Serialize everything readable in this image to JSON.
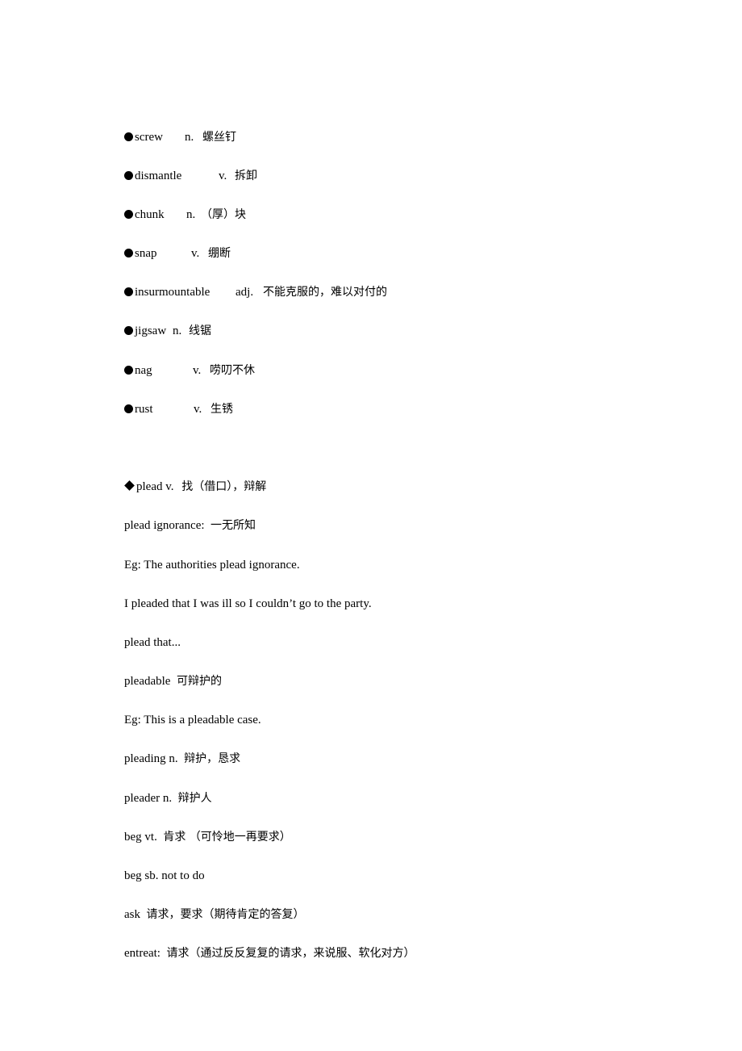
{
  "vocab_list": [
    {
      "word": "screw",
      "pos": "n.",
      "meaning": "螺丝钉"
    },
    {
      "word": "dismantle",
      "pos": "v.",
      "meaning": "拆卸"
    },
    {
      "word": "chunk",
      "pos": "n.",
      "meaning": "（厚）块"
    },
    {
      "word": "snap",
      "pos": "v.",
      "meaning": "绷断"
    },
    {
      "word": "insurmountable",
      "pos": "adj.",
      "meaning": "不能克服的，难以对付的"
    },
    {
      "word": "jigsaw",
      "pos": "n.",
      "meaning": "线锯"
    },
    {
      "word": "nag",
      "pos": "v.",
      "meaning": "唠叨不休"
    },
    {
      "word": "rust",
      "pos": "v.",
      "meaning": "生锈"
    }
  ],
  "plead_section": {
    "heading": {
      "word": "plead",
      "pos": "v.",
      "meaning": "找（借口），辩解"
    },
    "lines": [
      {
        "en": "plead ignorance:",
        "cn": "一无所知"
      },
      {
        "en": "Eg: The authorities plead ignorance.",
        "cn": ""
      },
      {
        "en": "I pleaded that I was ill so I couldn’t go to the party.",
        "cn": ""
      },
      {
        "en": "plead that...",
        "cn": ""
      },
      {
        "en": "pleadable",
        "cn": "可辩护的"
      },
      {
        "en": "Eg: This is a pleadable case.",
        "cn": ""
      },
      {
        "en": "pleading n.",
        "cn": "辩护，恳求"
      },
      {
        "en": "pleader n.",
        "cn": "辩护人"
      },
      {
        "en": "beg vt.",
        "cn": "肯求 （可怜地一再要求）"
      },
      {
        "en": "beg sb. not to do",
        "cn": ""
      },
      {
        "en": "ask",
        "cn": "请求，要求（期待肯定的答复）"
      },
      {
        "en": "entreat:",
        "cn": "请求（通过反反复复的请求，来说服、软化对方）"
      }
    ]
  }
}
